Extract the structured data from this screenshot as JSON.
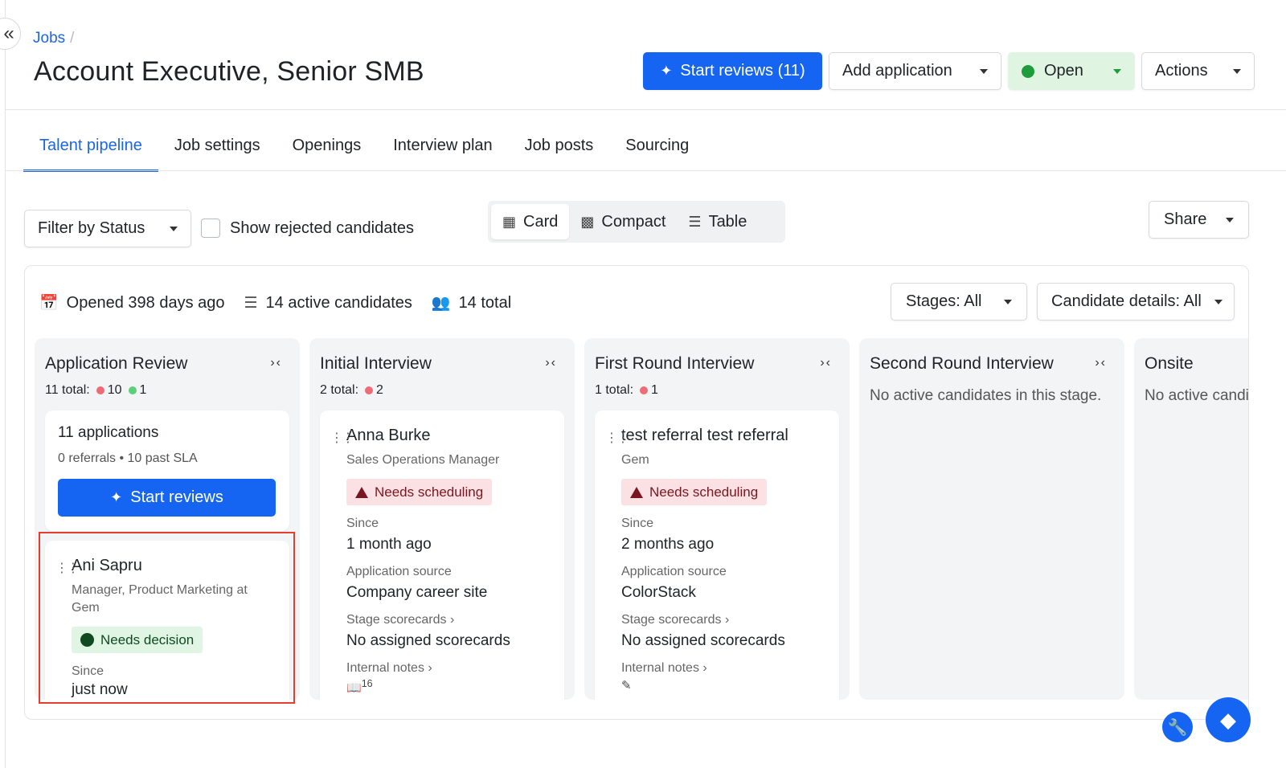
{
  "breadcrumb": {
    "jobs": "Jobs",
    "sep": "/"
  },
  "header": {
    "title": "Account Executive, Senior SMB",
    "start_reviews": "Start reviews (11)",
    "add_application": "Add application",
    "status": "Open",
    "actions": "Actions"
  },
  "tabs": [
    "Talent pipeline",
    "Job settings",
    "Openings",
    "Interview plan",
    "Job posts",
    "Sourcing"
  ],
  "toolbar": {
    "filter": "Filter by Status",
    "show_rejected": "Show rejected candidates",
    "views": [
      "Card",
      "Compact",
      "Table"
    ],
    "share": "Share"
  },
  "board": {
    "stats": {
      "opened": "Opened 398 days ago",
      "active": "14 active candidates",
      "total": "14 total"
    },
    "stages_filter": "Stages: All",
    "details_filter": "Candidate details: All",
    "columns": [
      {
        "title": "Application Review",
        "count_label": "11 total:",
        "red_count": "10",
        "green_count": "1",
        "summary": {
          "title": "11 applications",
          "sub": "0 referrals • 10 past SLA",
          "button": "Start reviews"
        },
        "candidates": [
          {
            "name": "Ani Sapru",
            "sub": "Manager, Product Marketing at Gem",
            "badge": "Needs decision",
            "since_label": "Since",
            "since_value": "just now"
          }
        ]
      },
      {
        "title": "Initial Interview",
        "count_label": "2 total:",
        "red_count": "2",
        "candidates": [
          {
            "name": "Anna Burke",
            "sub": "Sales Operations Manager",
            "badge": "Needs scheduling",
            "since_label": "Since",
            "since_value": "1 month ago",
            "source_label": "Application source",
            "source_value": "Company career site",
            "scorecards_label": "Stage scorecards ›",
            "scorecards_value": "No assigned scorecards",
            "notes_label": "Internal notes ›",
            "notes_count": "16"
          }
        ]
      },
      {
        "title": "First Round Interview",
        "count_label": "1 total:",
        "red_count": "1",
        "candidates": [
          {
            "name": "test referral test referral",
            "sub": "Gem",
            "badge": "Needs scheduling",
            "since_label": "Since",
            "since_value": "2 months ago",
            "source_label": "Application source",
            "source_value": "ColorStack",
            "scorecards_label": "Stage scorecards ›",
            "scorecards_value": "No assigned scorecards",
            "notes_label": "Internal notes ›"
          }
        ]
      },
      {
        "title": "Second Round Interview",
        "empty": "No active candidates in this stage."
      },
      {
        "title": "Onsite",
        "empty": "No active candidates in this stage."
      }
    ]
  },
  "colors": {
    "primary": "#1565f2",
    "link": "#1a66e6",
    "status_green": "#1e9b3a",
    "alert_red": "#7a1620",
    "highlight": "#e53e2e"
  }
}
